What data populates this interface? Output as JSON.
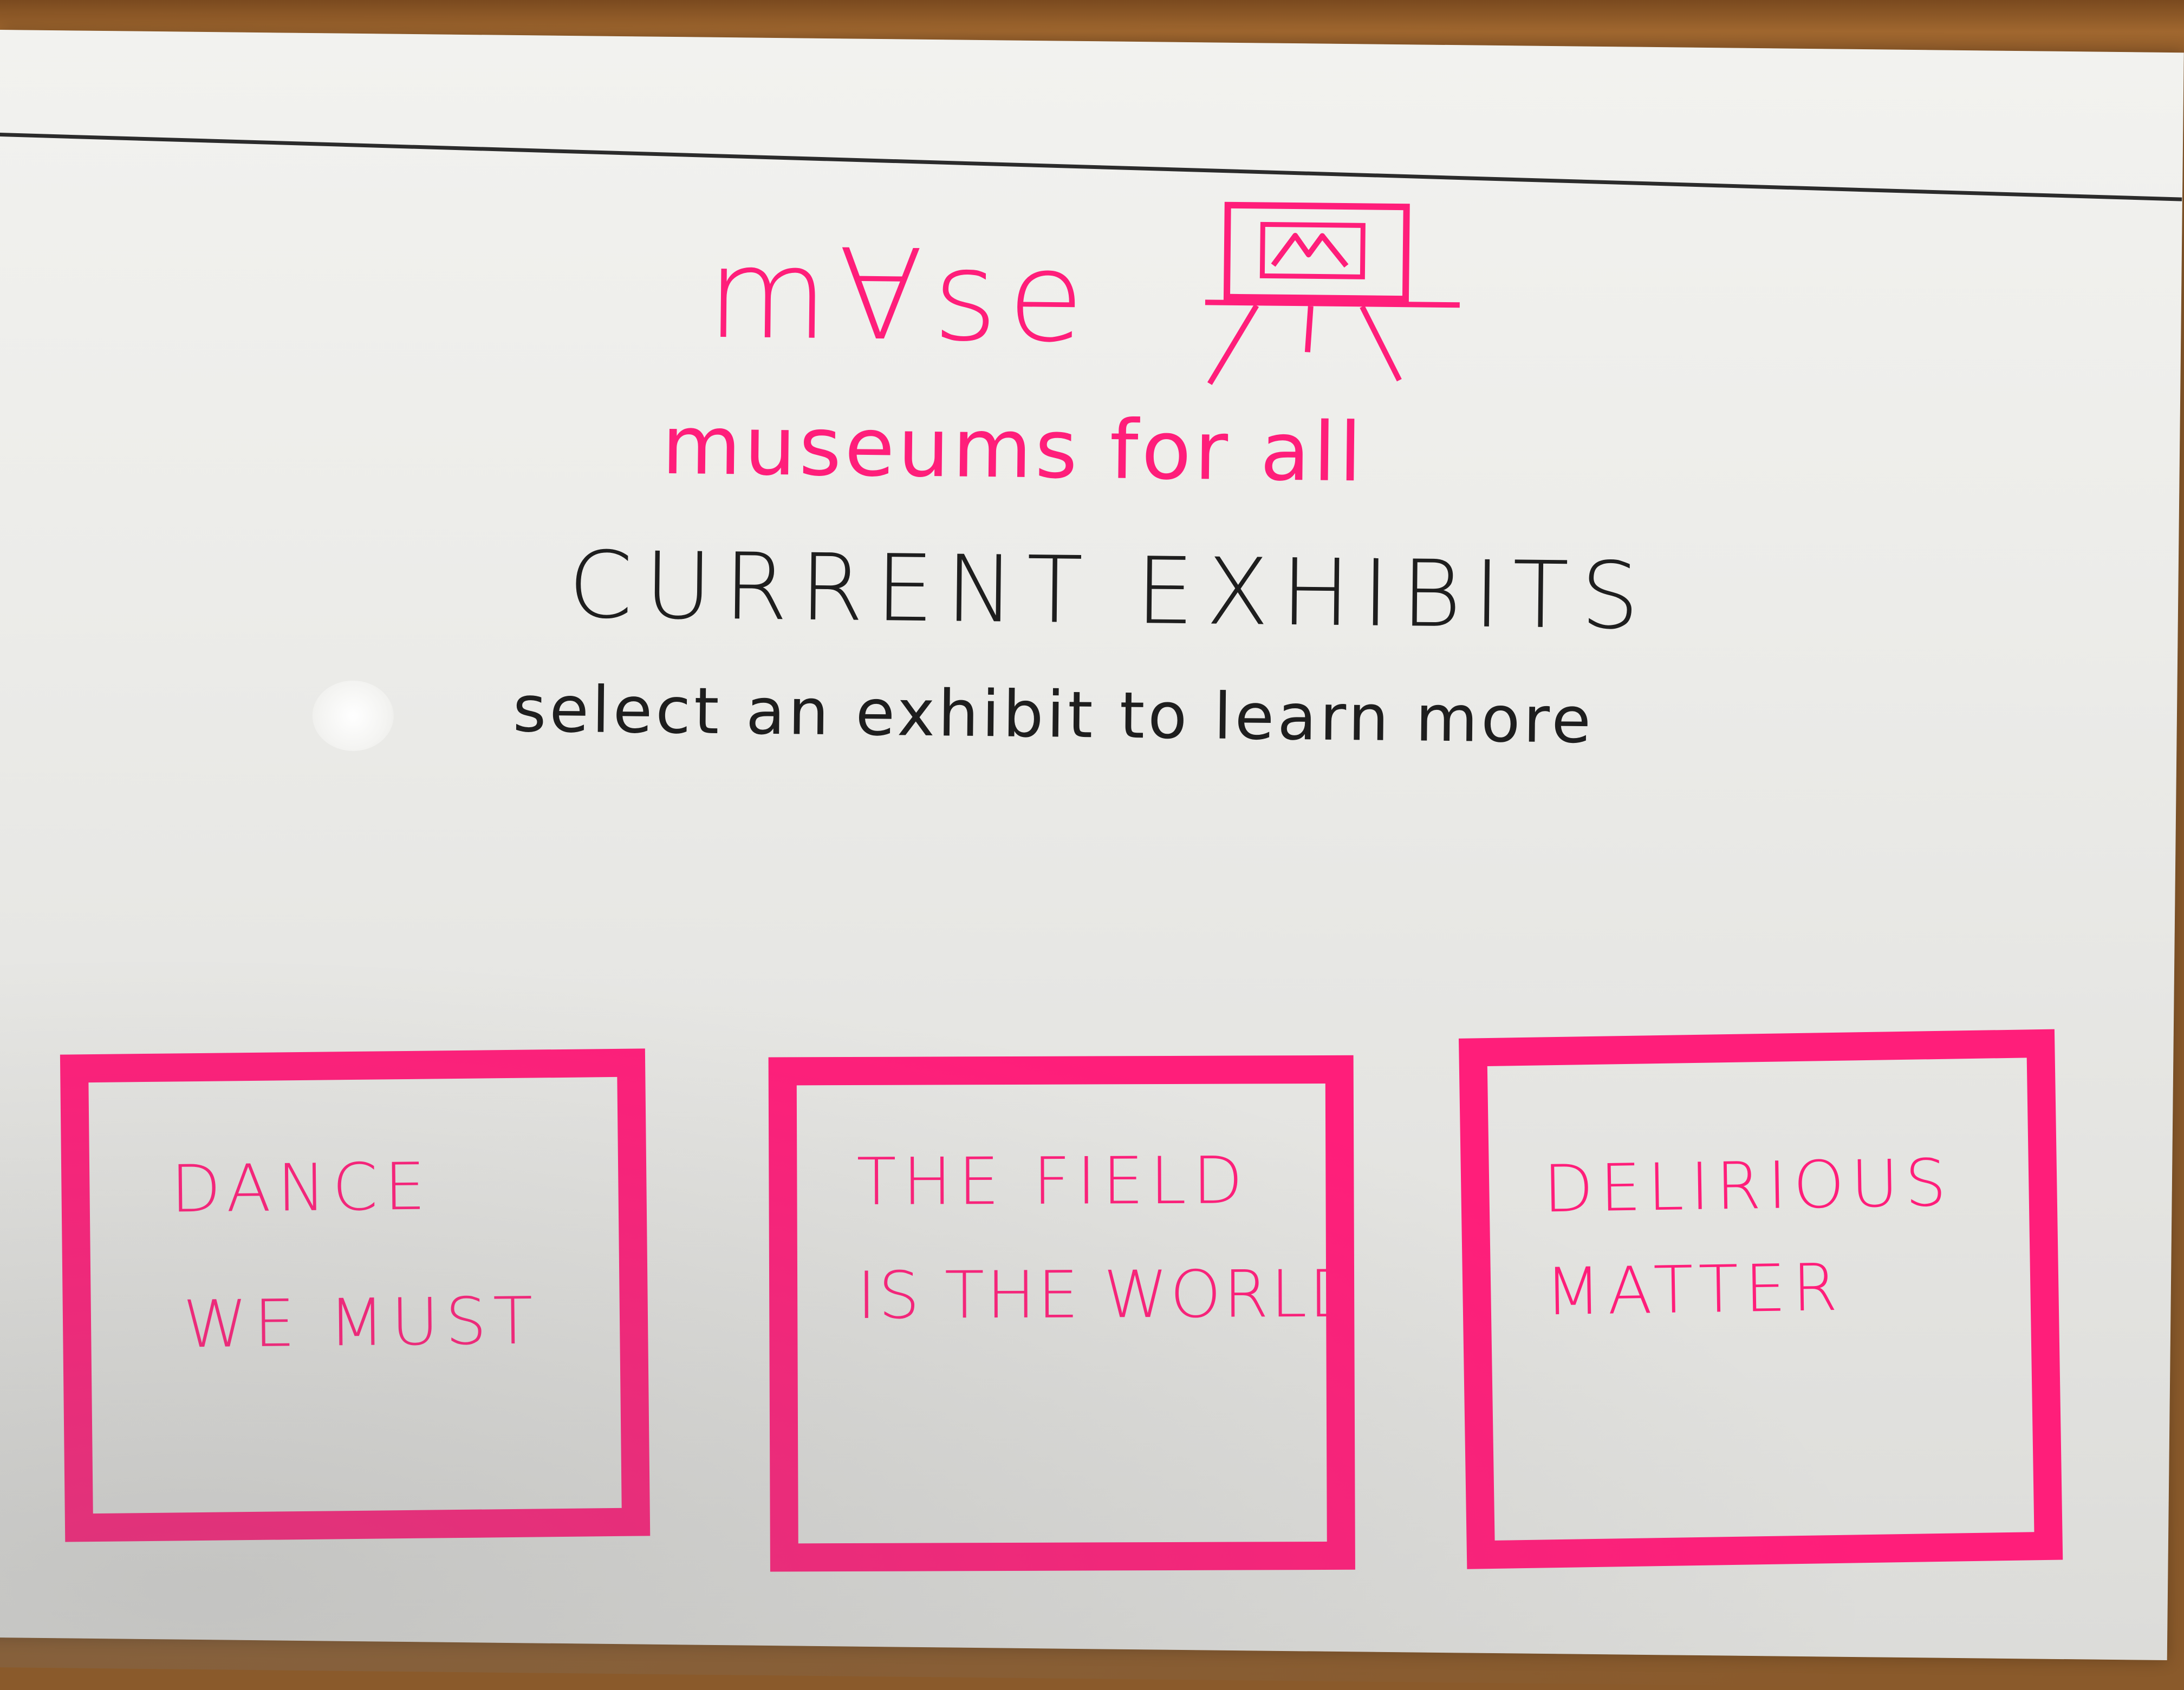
{
  "app": {
    "logo_text": "m∀se",
    "logo_icon": "easel-icon",
    "tagline": "museums for all"
  },
  "main": {
    "title": "CURRENT EXHIBITS",
    "subtitle": "select an exhibit to learn more"
  },
  "exhibits": [
    {
      "line1": "DANCE",
      "line2": "WE  MUST"
    },
    {
      "line1": "THE  FIELD",
      "line2": "IS THE WORLD"
    },
    {
      "line1": "DELIRIOUS",
      "line2": "MATTER"
    }
  ],
  "colors": {
    "accent": "#ff1e7a",
    "ink": "#1e1e1e",
    "paper": "#ecece9"
  }
}
